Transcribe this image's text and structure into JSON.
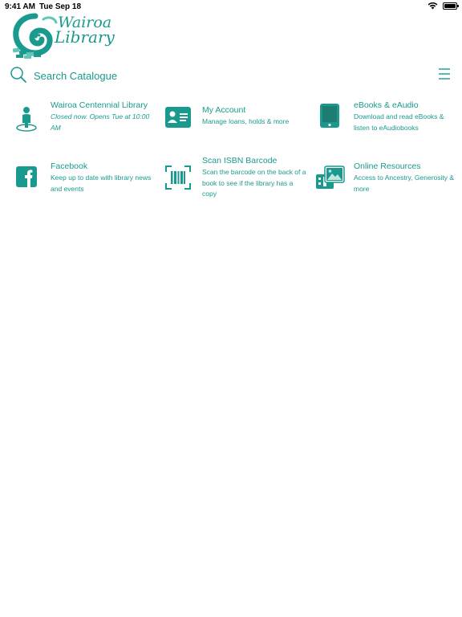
{
  "status_bar": {
    "time": "9:41 AM",
    "date": "Tue Sep 18"
  },
  "logo": {
    "line1": "Wairoa",
    "line2": "Library"
  },
  "search": {
    "placeholder": "Search Catalogue"
  },
  "tiles": [
    {
      "title": "Wairoa Centennial Library",
      "desc": "Closed now. Opens Tue at 10:00 AM",
      "icon": "location-person-icon"
    },
    {
      "title": "My Account",
      "desc": "Manage loans, holds & more",
      "icon": "id-card-icon"
    },
    {
      "title": "eBooks & eAudio",
      "desc": "Download and read eBooks & listen to eAudiobooks",
      "icon": "tablet-icon"
    },
    {
      "title": "Facebook",
      "desc": "Keep up to date with library news and events",
      "icon": "facebook-icon"
    },
    {
      "title": "Scan ISBN Barcode",
      "desc": "Scan the barcode on the back of a book to see if the library has a copy",
      "icon": "barcode-scan-icon"
    },
    {
      "title": "Online Resources",
      "desc": "Access to Ancestry, Generosity & more",
      "icon": "online-resources-icon"
    }
  ],
  "colors": {
    "accent": "#1a9a8e",
    "logo_light": "#62c6b6"
  }
}
